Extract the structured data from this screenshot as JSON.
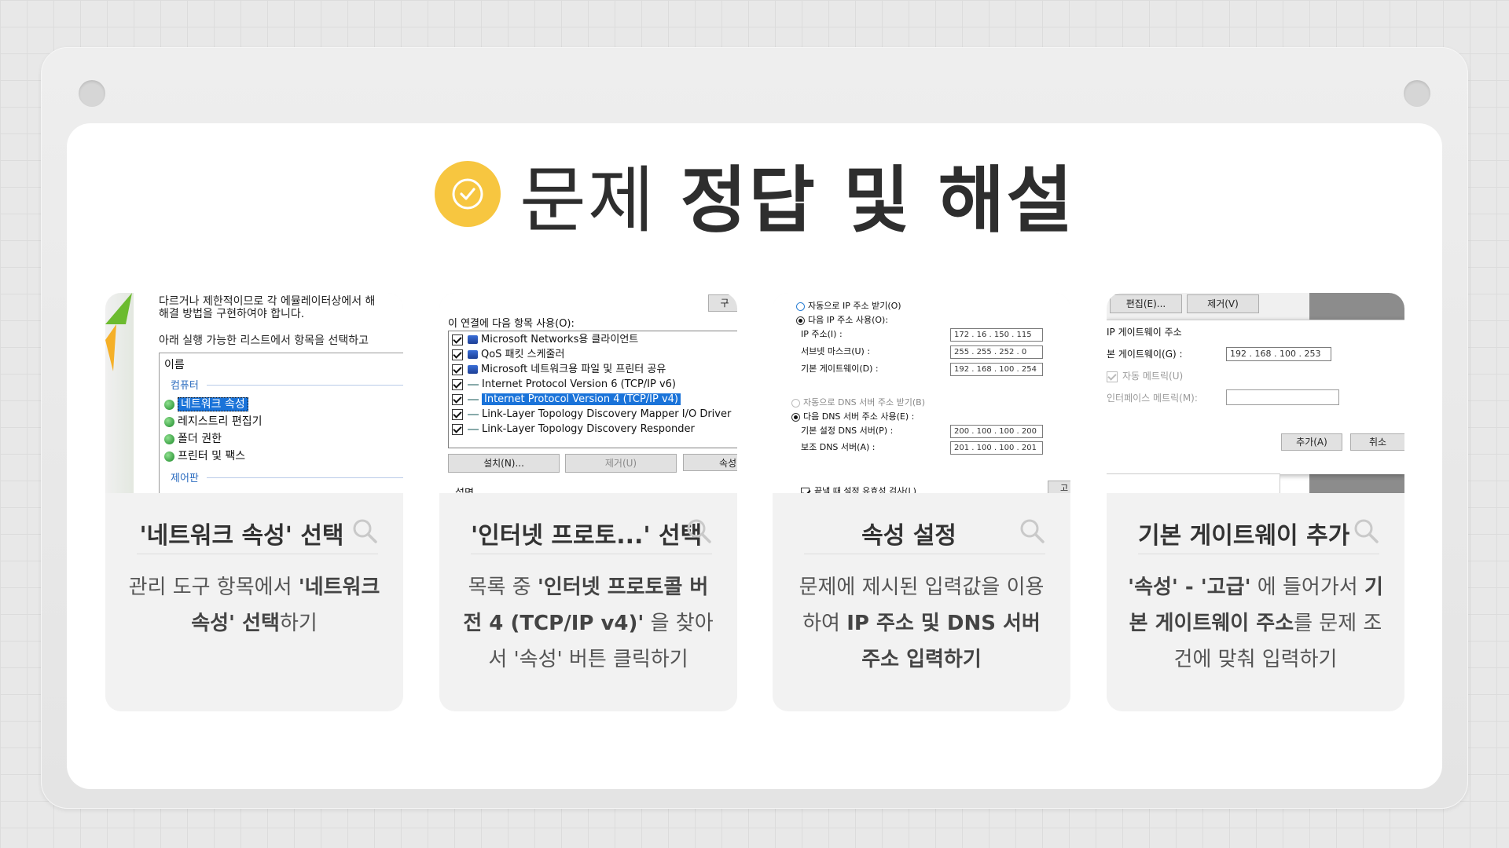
{
  "heading": {
    "light": "문제",
    "bold": "정답 및 해설"
  },
  "colors": {
    "accent": "#f7c640",
    "card_bg": "#f2f2f2",
    "title_text": "#2e2e2e"
  },
  "cards": [
    {
      "title": "'네트워크 속성' 선택",
      "desc": [
        {
          "t": "관리 도구 항목에서 ",
          "b": false
        },
        {
          "t": "'네트워크 속성'",
          "b": true
        },
        {
          "t": " 선택",
          "b": true
        },
        {
          "t": "하기",
          "b": false
        }
      ],
      "shot": {
        "top_text_1": "다르거나 제한적이므로 각 에뮬레이터상에서 해",
        "top_text_2": "해결 방법을 구현하여야 합니다.",
        "instruction": "아래 실행 가능한 리스트에서 항목을 선택하고",
        "col_header": "이름",
        "group1": "컴퓨터",
        "items": [
          "네트워크 속성",
          "레지스트리 편집기",
          "폴더 권한",
          "프린터 및 팩스"
        ],
        "group2": "제어판"
      }
    },
    {
      "title": "'인터넷 프로토...' 선택",
      "desc": [
        {
          "t": "목록 중 ",
          "b": false
        },
        {
          "t": "'인터넷 프로토콜 버전 4 (TCP/IP v4)'",
          "b": true
        },
        {
          "t": " 을 찾아서 '속성' 버튼 클릭하기",
          "b": false
        }
      ],
      "shot": {
        "top_button": "구",
        "header": "이 연결에 다음 항목 사용(O):",
        "items": [
          "Microsoft Networks용 클라이언트",
          "QoS 패킷 스케줄러",
          "Microsoft 네트워크용 파일 및 프린터 공유",
          "Internet Protocol Version 6 (TCP/IP v6)",
          "Internet Protocol Version 4 (TCP/IP v4)",
          "Link-Layer Topology Discovery Mapper I/O Driver",
          "Link-Layer Topology Discovery Responder"
        ],
        "btn_install": "설치(N)...",
        "btn_remove": "제거(U)",
        "btn_props": "속성",
        "footer": "설명"
      }
    },
    {
      "title": "속성 설정",
      "desc": [
        {
          "t": "문제에 제시된 입력값을 이용하여 ",
          "b": false
        },
        {
          "t": "IP 주소 및 DNS 서버 주소 입력하기",
          "b": true
        }
      ],
      "shot": {
        "auto_ip": "자동으로 IP 주소 받기(O)",
        "use_ip": "다음 IP 주소 사용(O):",
        "ip_label": "IP 주소(I) :",
        "ip_value": "172 . 16 . 150 . 115",
        "mask_label": "서브넷 마스크(U) :",
        "mask_value": "255 . 255 . 252 . 0",
        "gw_label": "기본 게이트웨이(D) :",
        "gw_value": "192 . 168 . 100 . 254",
        "auto_dns": "자동으로 DNS 서버 주소 받기(B)",
        "use_dns": "다음 DNS 서버 주소 사용(E) :",
        "dns1_label": "기본 설정 DNS 서버(P) :",
        "dns1_value": "200 . 100 . 100 . 200",
        "dns2_label": "보조 DNS 서버(A) :",
        "dns2_value": "201 . 100 . 100 . 201",
        "validate": "끝낼 때 설정 유효성 검사(L)",
        "adv": "고"
      }
    },
    {
      "title": "기본 게이트웨이 추가",
      "desc": [
        {
          "t": "'속성' - '고급'",
          "b": true
        },
        {
          "t": " 에 들어가서 ",
          "b": false
        },
        {
          "t": "기본 게이트웨이 주소",
          "b": true
        },
        {
          "t": "를 문제 조건에 맞춰 입력하기",
          "b": false
        }
      ],
      "shot": {
        "btn_edit": "편집(E)...",
        "btn_remove": "제거(V)",
        "group_title": "IP 게이트웨이 주소",
        "gw_label": "본 게이트웨이(G) :",
        "gw_value": "192 . 168 . 100 . 253",
        "auto_metric": "자동 메트릭(U)",
        "if_metric": "인터페이스 메트릭(M):",
        "btn_add": "추가(A)",
        "btn_cancel": "취소"
      }
    }
  ]
}
